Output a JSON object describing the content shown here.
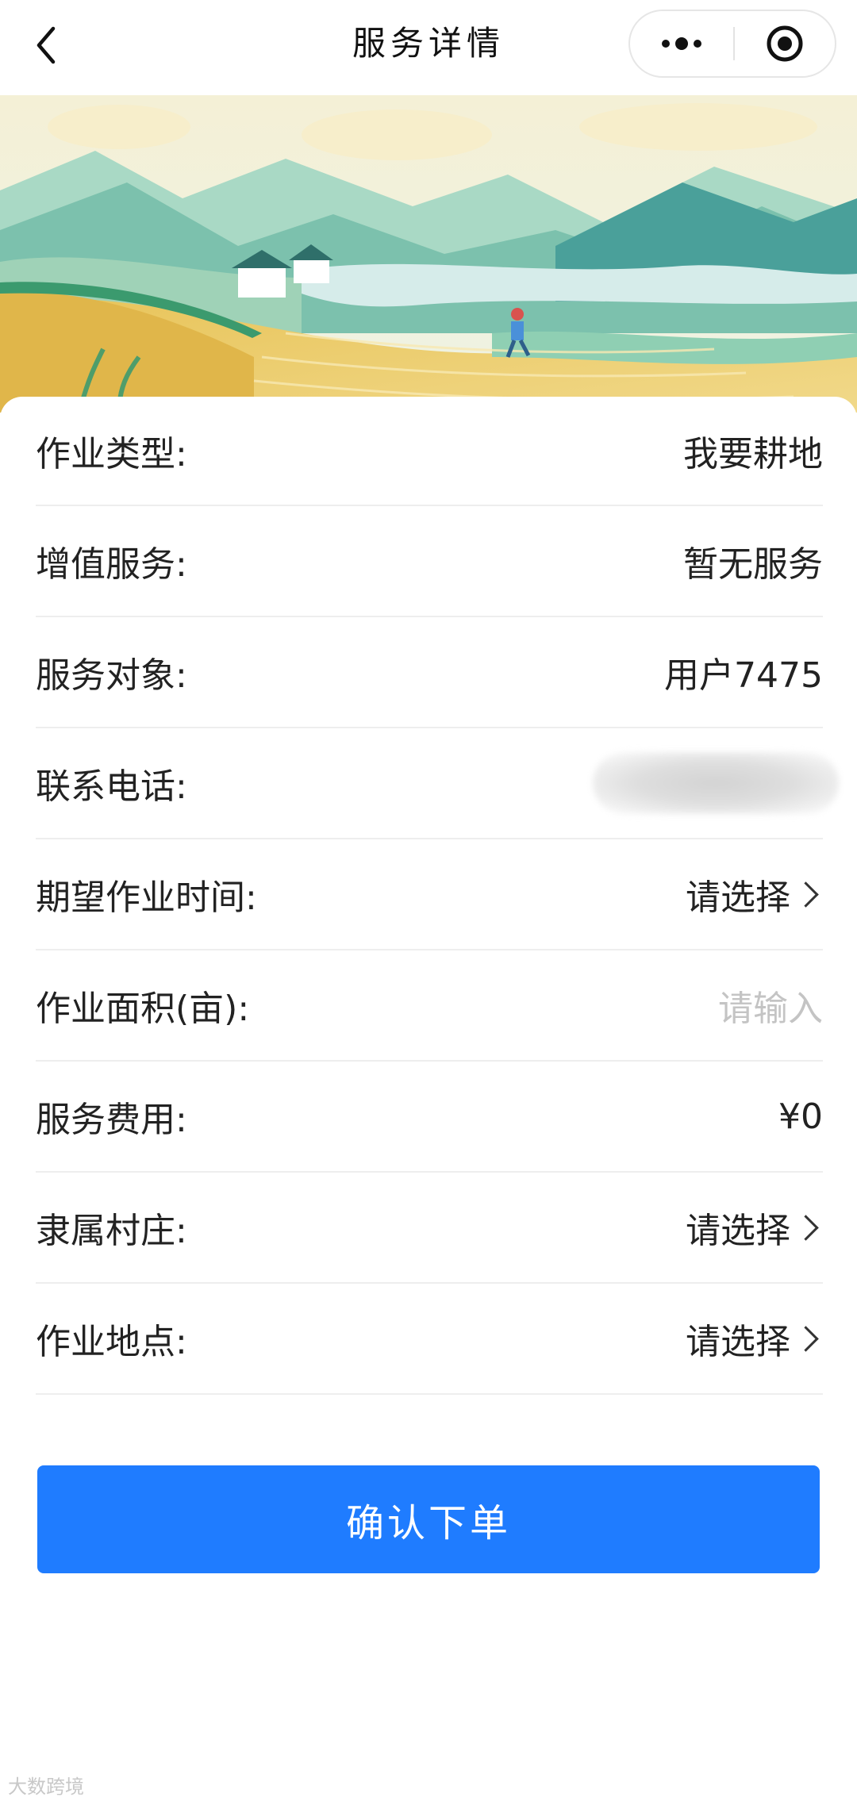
{
  "header": {
    "title": "服务详情"
  },
  "form": {
    "rows": [
      {
        "label": "作业类型:",
        "value": "我要耕地"
      },
      {
        "label": "增值服务:",
        "value": "暂无服务"
      },
      {
        "label": "服务对象:",
        "value": "用户7475"
      },
      {
        "label": "联系电话:",
        "value": ""
      },
      {
        "label": "期望作业时间:",
        "value": "请选择"
      },
      {
        "label": "作业面积(亩):",
        "placeholder": "请输入"
      },
      {
        "label": "服务费用:",
        "value": "¥0"
      },
      {
        "label": "隶属村庄:",
        "value": "请选择"
      },
      {
        "label": "作业地点:",
        "value": "请选择"
      }
    ]
  },
  "submit": {
    "label": "确认下单"
  },
  "watermark": {
    "text": "大数跨境"
  },
  "colors": {
    "accent": "#1f7cff",
    "placeholder": "#c4c4c4",
    "divider": "#eeeeee"
  },
  "icons": {
    "back": "chevron-left-icon",
    "more": "more-dots-icon",
    "close": "target-circle-icon",
    "row_arrow": "chevron-right-icon"
  }
}
